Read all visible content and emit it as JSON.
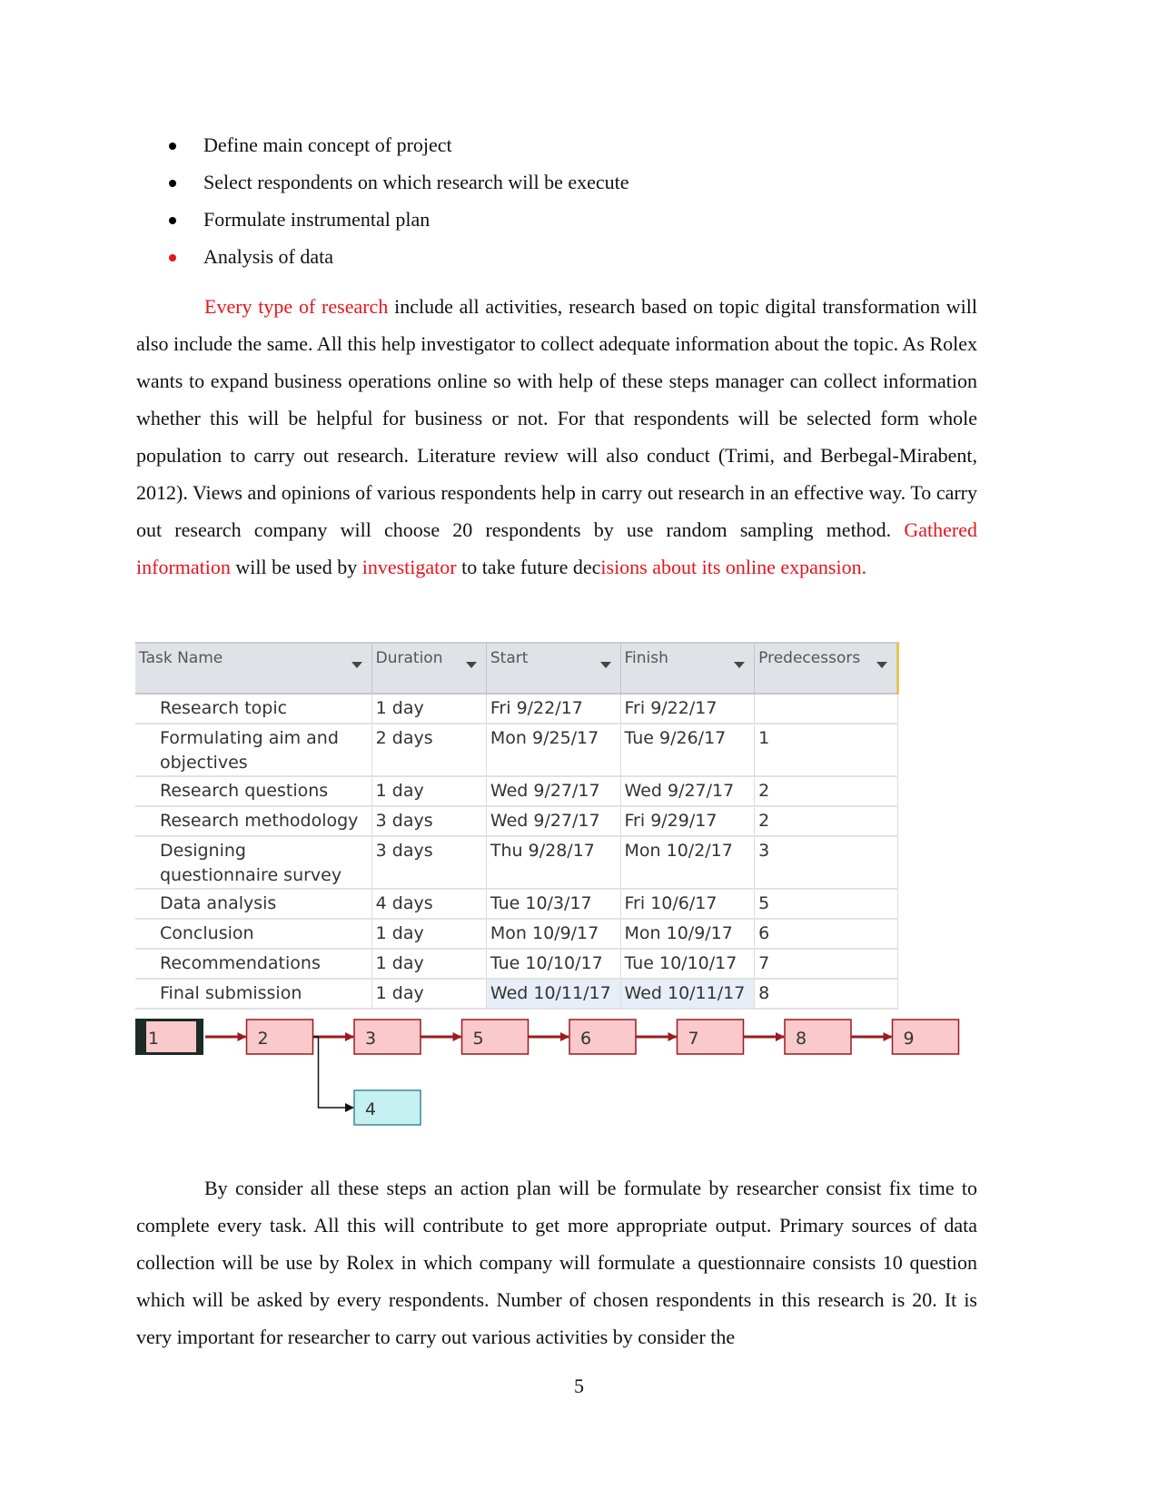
{
  "bullets": [
    {
      "text": "Define main concept of project",
      "bullet_color": "black"
    },
    {
      "text": "Select respondents on which research will be execute",
      "bullet_color": "black"
    },
    {
      "text": "Formulate instrumental plan",
      "bullet_color": "black"
    },
    {
      "text": "Analysis of data",
      "bullet_color": "red"
    }
  ],
  "paragraph1": {
    "red_lead": "Every type of research",
    "text_a": " include all activities, research based on topic digital transformation will also include the same. All this help investigator to collect adequate information about the topic. As Rolex wants to expand business operations online so with help of these steps manager can collect information whether this will be helpful for business or not. For that respondents will be selected form whole population to carry out research. Literature review will also conduct (Trimi, and Berbegal-Mirabent, 2012). Views and opinions of various respondents help in carry out research in an effective way. To carry out research company will choose 20 respondents by use random sampling method. ",
    "red_b": "Gathered information",
    "text_b": " will be used by ",
    "red_c": "investigator",
    "text_c": " to take future dec",
    "red_d": "isions about  its online expansion."
  },
  "gantt_table": {
    "columns": [
      "Task Name",
      "Duration",
      "Start",
      "Finish",
      "Predecessors"
    ],
    "rows": [
      {
        "id": 1,
        "task": "Research topic",
        "duration": "1 day",
        "start": "Fri 9/22/17",
        "finish": "Fri 9/22/17",
        "predecessors": ""
      },
      {
        "id": 2,
        "task": "Formulating aim and objectives",
        "duration": "2 days",
        "start": "Mon 9/25/17",
        "finish": "Tue 9/26/17",
        "predecessors": "1"
      },
      {
        "id": 3,
        "task": "Research questions",
        "duration": "1 day",
        "start": "Wed 9/27/17",
        "finish": "Wed 9/27/17",
        "predecessors": "2"
      },
      {
        "id": 4,
        "task": "Research methodology",
        "duration": "3 days",
        "start": "Wed 9/27/17",
        "finish": "Fri 9/29/17",
        "predecessors": "2"
      },
      {
        "id": 5,
        "task": "Designing questionnaire survey",
        "duration": "3 days",
        "start": "Thu 9/28/17",
        "finish": "Mon 10/2/17",
        "predecessors": "3"
      },
      {
        "id": 6,
        "task": "Data analysis",
        "duration": "4 days",
        "start": "Tue 10/3/17",
        "finish": "Fri 10/6/17",
        "predecessors": "5"
      },
      {
        "id": 7,
        "task": "Conclusion",
        "duration": "1 day",
        "start": "Mon 10/9/17",
        "finish": "Mon 10/9/17",
        "predecessors": "6"
      },
      {
        "id": 8,
        "task": "Recommendations",
        "duration": "1 day",
        "start": "Tue 10/10/17",
        "finish": "Tue 10/10/17",
        "predecessors": "7"
      },
      {
        "id": 9,
        "task": "Final submission",
        "duration": "1 day",
        "start": "Wed 10/11/17",
        "finish": "Wed 10/11/17",
        "predecessors": "8"
      }
    ]
  },
  "network_diagram": {
    "critical_color": "#f9c9cb",
    "critical_border": "#9b1b1f",
    "noncritical_color": "#c5f1f3",
    "noncritical_border": "#3f8a8f",
    "main_path": [
      "1",
      "2",
      "3",
      "5",
      "6",
      "7",
      "8",
      "9"
    ],
    "branch": {
      "from": "2",
      "to": "4"
    }
  },
  "paragraph2": {
    "text": "By consider all these steps an action plan will be formulate by researcher consist fix time to complete every task. All this will contribute to get more appropriate output. Primary sources of data collection will be use by Rolex in which company will formulate a questionnaire consists 10 question which will be asked by every respondents. Number of chosen respondents in this research is 20. It is very important for researcher to carry out various activities by consider the"
  },
  "page_number": "5"
}
